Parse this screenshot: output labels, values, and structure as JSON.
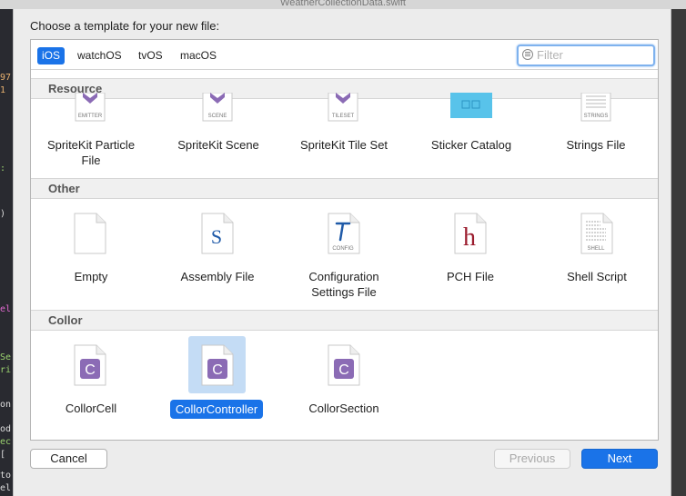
{
  "window": {
    "title": "WeatherCollectionData.swift"
  },
  "sheet": {
    "title": "Choose a template for your new file:"
  },
  "tabs": [
    {
      "label": "iOS",
      "active": true
    },
    {
      "label": "watchOS"
    },
    {
      "label": "tvOS"
    },
    {
      "label": "macOS"
    }
  ],
  "filter": {
    "placeholder": "Filter",
    "value": ""
  },
  "sections": [
    {
      "title": "Resource",
      "items": [
        {
          "label": "SpriteKit Particle File",
          "icon": "emitter-icon",
          "badge": "EMITTER"
        },
        {
          "label": "SpriteKit Scene",
          "icon": "scene-icon",
          "badge": "SCENE"
        },
        {
          "label": "SpriteKit Tile Set",
          "icon": "tileset-icon",
          "badge": "TILESET"
        },
        {
          "label": "Sticker Catalog",
          "icon": "sticker-catalog-icon"
        },
        {
          "label": "Strings File",
          "icon": "strings-icon",
          "badge": "STRINGS"
        }
      ]
    },
    {
      "title": "Other",
      "items": [
        {
          "label": "Empty",
          "icon": "empty-file-icon"
        },
        {
          "label": "Assembly File",
          "icon": "assembly-file-icon",
          "glyph": "S"
        },
        {
          "label": "Configuration Settings File",
          "icon": "config-file-icon",
          "badge": "CONFIG"
        },
        {
          "label": "PCH File",
          "icon": "pch-file-icon",
          "glyph": "h"
        },
        {
          "label": "Shell Script",
          "icon": "shell-script-icon",
          "badge": "SHELL"
        }
      ]
    },
    {
      "title": "Collor",
      "items": [
        {
          "label": "CollorCell",
          "icon": "collor-c-icon",
          "glyph": "C"
        },
        {
          "label": "CollorController",
          "icon": "collor-c-icon",
          "glyph": "C",
          "selected": true
        },
        {
          "label": "CollorSection",
          "icon": "collor-c-icon",
          "glyph": "C"
        }
      ]
    }
  ],
  "buttons": {
    "cancel": "Cancel",
    "previous": "Previous",
    "next": "Next"
  },
  "colors": {
    "accent": "#1a73e8",
    "purple": "#8b6bb5",
    "pch": "#9b1c2e",
    "assembly": "#1f5aa8",
    "sticker": "#58c3ea"
  }
}
